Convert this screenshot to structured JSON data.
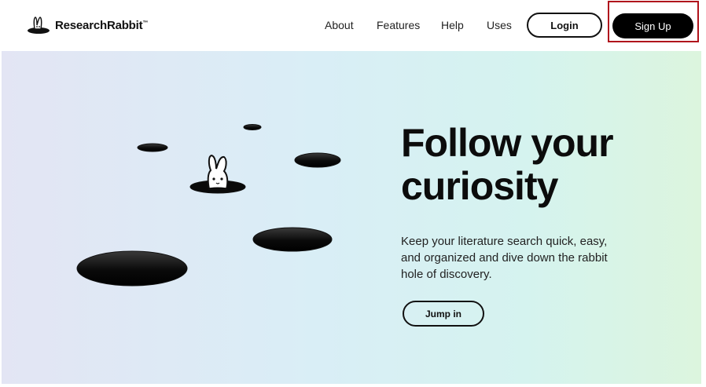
{
  "header": {
    "logo_text": "ResearchRabbit",
    "logo_tm": "™",
    "nav": [
      "About",
      "Features",
      "Help",
      "Uses"
    ],
    "login_label": "Login",
    "signup_label": "Sign Up"
  },
  "hero": {
    "title_line1": "Follow your",
    "title_line2": "curiosity",
    "description": "Keep your literature search quick, easy, and organized and dive down the rabbit hole of discovery.",
    "cta_label": "Jump in"
  },
  "colors": {
    "primary": "#000000",
    "highlight": "#b0141c",
    "gradient_start": "#e3e5f4",
    "gradient_end": "#dcf5de"
  },
  "icons": [
    "rabbit-logo-icon",
    "rabbit-hole-icon"
  ]
}
